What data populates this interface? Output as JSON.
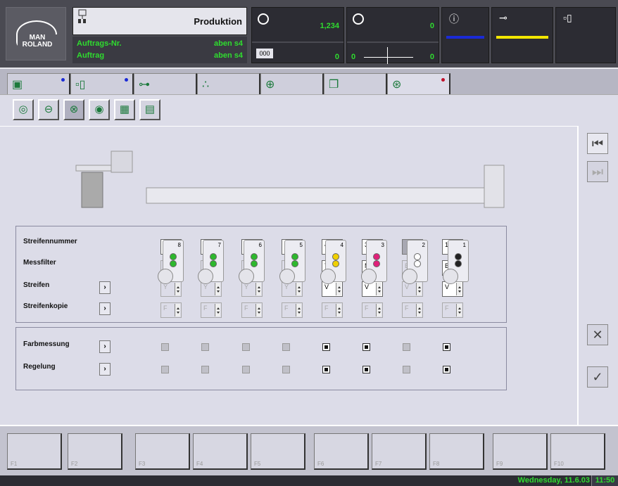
{
  "header": {
    "logo_text": "MAN ROLAND",
    "production_label": "Produktion",
    "job_label_1": "Auftrags-Nr.",
    "job_label_2": "Auftrag",
    "job_value_1": "aben s4",
    "job_value_2": "aben s4",
    "counter1_top": "1,234",
    "counter1_box": "000",
    "counter1_bottom": "0",
    "counter2_top": "0",
    "counter2_left": "0",
    "counter2_right": "0",
    "status_colors": {
      "blue": "#1a2ad6",
      "yellow": "#f2e600"
    }
  },
  "tabs": [
    {
      "icon": "machine-overview-icon",
      "dot": "#1a2ad6"
    },
    {
      "icon": "inking-unit-icon",
      "dot": "#1a2ad6"
    },
    {
      "icon": "feeder-icon",
      "dot": ""
    },
    {
      "icon": "dampening-icon",
      "dot": ""
    },
    {
      "icon": "register-icon",
      "dot": ""
    },
    {
      "icon": "format-icon",
      "dot": ""
    },
    {
      "icon": "color-measurement-icon",
      "dot": "#c0102a"
    }
  ],
  "units": [
    {
      "num": "8",
      "dots": [
        "#2db82d",
        "#2db82d"
      ]
    },
    {
      "num": "7",
      "dots": [
        "#2db82d",
        "#2db82d"
      ]
    },
    {
      "num": "6",
      "dots": [
        "#2db82d",
        "#2db82d"
      ]
    },
    {
      "num": "5",
      "dots": [
        "#2db82d",
        "#2db82d"
      ]
    },
    {
      "num": "4",
      "dots": [
        "#f0d000",
        "#f0d000"
      ]
    },
    {
      "num": "3",
      "dots": [
        "#e0207a",
        "#e0207a"
      ]
    },
    {
      "num": "2",
      "dots": [
        "#ffffff",
        "#ffffff"
      ]
    },
    {
      "num": "1",
      "dots": [
        "#222222",
        "#222222"
      ]
    }
  ],
  "rows": {
    "streifennummer": "Streifennummer",
    "messfilter": "Messfilter",
    "streifen": "Streifen",
    "streifenkopie": "Streifenkopie",
    "farbmessung": "Farbmessung",
    "regelung": "Regelung"
  },
  "columns": [
    {
      "nr": "",
      "filter": "B",
      "streifen": "Y",
      "kopie": "F",
      "farb": false,
      "reg": false
    },
    {
      "nr": "",
      "filter": "B",
      "streifen": "Y",
      "kopie": "F",
      "farb": false,
      "reg": false
    },
    {
      "nr": "",
      "filter": "B",
      "streifen": "Y",
      "kopie": "F",
      "farb": false,
      "reg": false
    },
    {
      "nr": "",
      "filter": "B",
      "streifen": "Y",
      "kopie": "F",
      "farb": false,
      "reg": false
    },
    {
      "nr": "4",
      "filter": "Y",
      "streifen": "V",
      "kopie": "F",
      "farb": true,
      "reg": true
    },
    {
      "nr": "3",
      "filter": "M",
      "streifen": "V",
      "kopie": "F",
      "farb": true,
      "reg": true
    },
    {
      "nr": "",
      "filter": "B",
      "streifen": "V",
      "kopie": "F",
      "farb": false,
      "reg": false
    },
    {
      "nr": "1",
      "filter": "B",
      "streifen": "V",
      "kopie": "F",
      "farb": true,
      "reg": true
    }
  ],
  "fkeys": [
    "F1",
    "F2",
    "F3",
    "F4",
    "F5",
    "F6",
    "F7",
    "F8",
    "F9",
    "F10"
  ],
  "status": {
    "date": "Wednesday, 11.6.03",
    "time": "11:50"
  }
}
